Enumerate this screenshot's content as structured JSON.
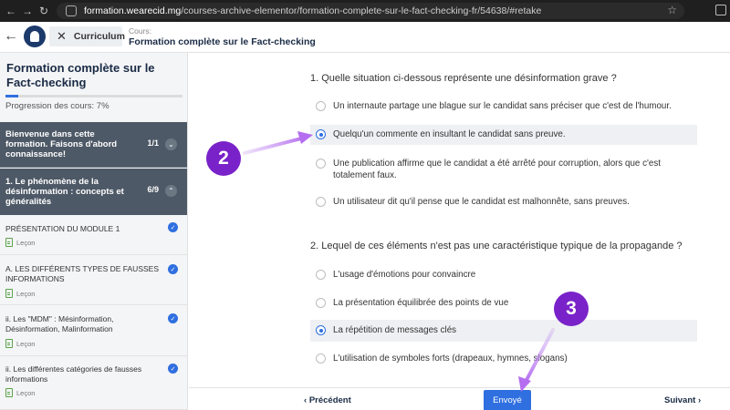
{
  "browser": {
    "url_host": "formation.wearecid.mg",
    "url_path": "/courses-archive-elementor/formation-complete-sur-le-fact-checking-fr/54638/#retake"
  },
  "header": {
    "curriculum_label": "Curriculum",
    "course_label": "Cours:",
    "course_title": "Formation complète sur le Fact-checking"
  },
  "sidebar": {
    "title": "Formation complète sur le Fact-checking",
    "progress_text": "Progression des cours: 7%",
    "progress_value": 0.07,
    "sections": [
      {
        "title": "Bienvenue dans cette formation. Faisons d'abord connaissance!",
        "count": "1/1",
        "expanded": false
      },
      {
        "title": "1. Le phénomène de la désinformation : concepts et généralités",
        "count": "6/9",
        "expanded": true
      }
    ],
    "lessons": [
      {
        "title": "PRÉSENTATION DU MODULE 1",
        "type": "Leçon",
        "done": true
      },
      {
        "title": "A. LES DIFFÉRENTS TYPES DE FAUSSES INFORMATIONS",
        "type": "Leçon",
        "done": true
      },
      {
        "title": "ii. Les \"MDM\" : Mésinformation, Désinformation, Malinformation",
        "type": "Leçon",
        "done": true
      },
      {
        "title": "ii. Les différentes catégories de fausses informations",
        "type": "Leçon",
        "done": true
      }
    ]
  },
  "quiz": {
    "questions": [
      {
        "text": "1. Quelle situation ci-dessous représente une désinformation grave ?",
        "selected": 1,
        "options": [
          "Un internaute partage une blague sur le candidat sans préciser que c'est de l'humour.",
          "Quelqu'un commente en insultant le candidat sans preuve.",
          "Une publication affirme que le candidat a été arrêté pour corruption, alors que c'est totalement faux.",
          "Un utilisateur dit qu'il pense que le candidat est malhonnête, sans preuves."
        ]
      },
      {
        "text": "2. Lequel de ces éléments n'est pas une caractéristique typique de la propagande ?",
        "selected": 2,
        "options": [
          "L'usage d'émotions pour convaincre",
          "La présentation équilibrée des points de vue",
          "La répétition de messages clés",
          "L'utilisation de symboles forts (drapeaux, hymnes, slogans)"
        ]
      }
    ]
  },
  "footer": {
    "prev_label": "Précédent",
    "submit_label": "Envoyé",
    "next_label": "Suivant"
  },
  "annotations": {
    "badge_2": "2",
    "badge_3": "3",
    "color": "#7a22c9"
  },
  "colors": {
    "accent": "#2f6fe0",
    "section_bg": "#4e5967",
    "check_green": "#5aa34a"
  }
}
